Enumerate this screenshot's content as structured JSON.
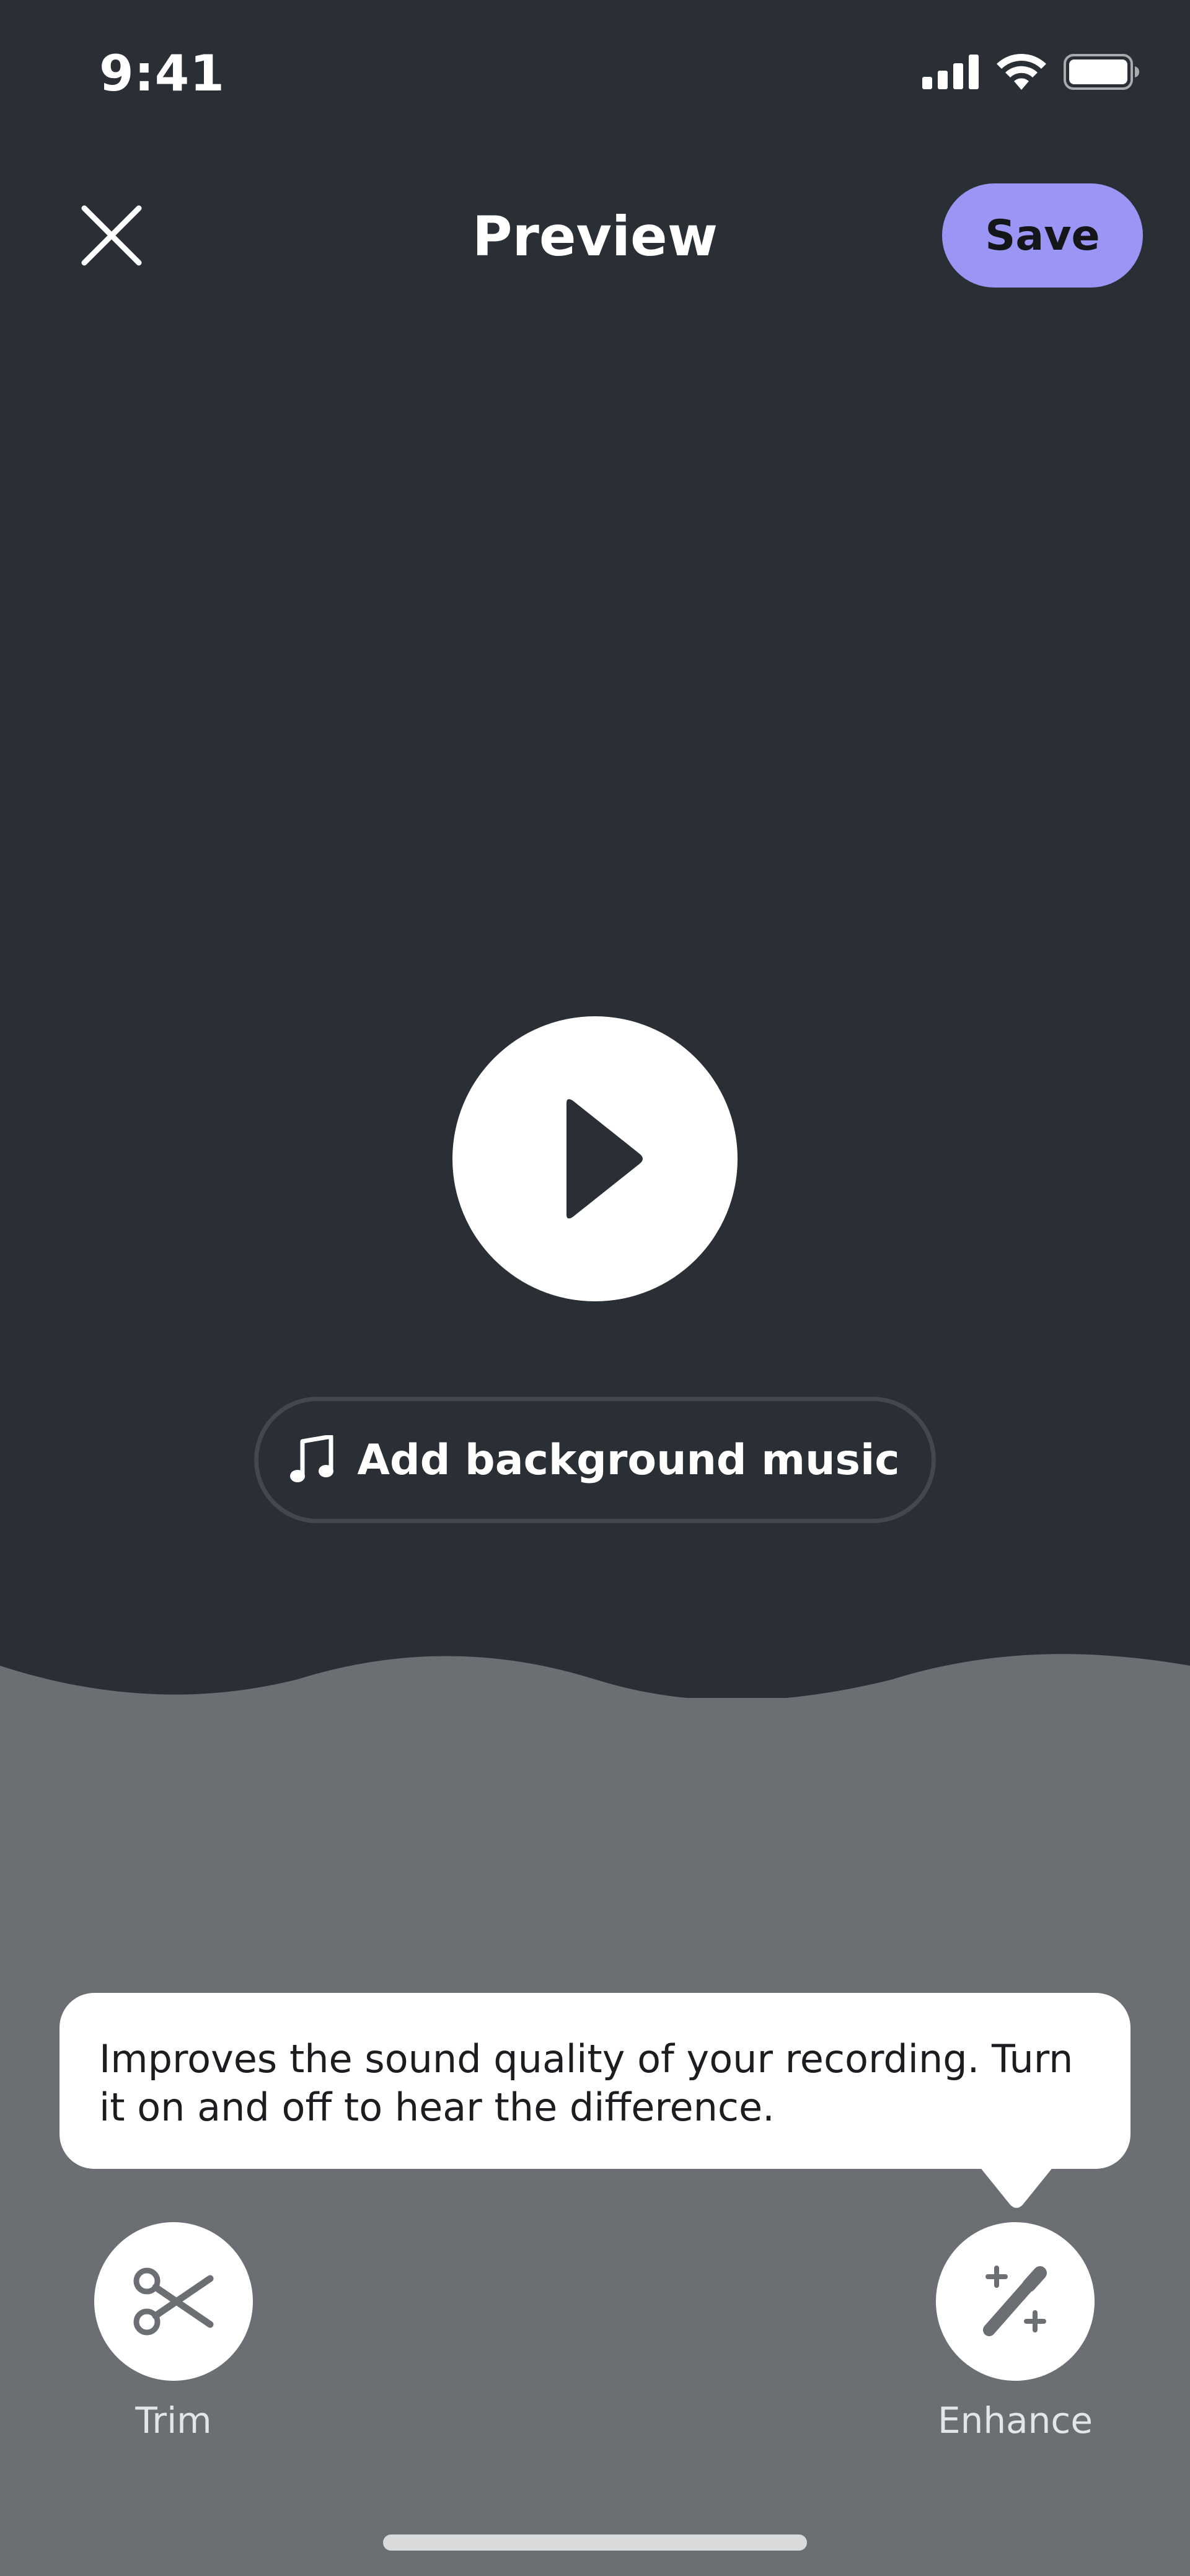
{
  "status_bar": {
    "time": "9:41"
  },
  "header": {
    "title": "Preview",
    "save_label": "Save"
  },
  "player": {
    "add_music_label": "Add background music"
  },
  "tooltip": {
    "text": "Improves the sound quality of your recording. Turn it on and off to hear the difference."
  },
  "tools": [
    {
      "label": "Trim",
      "icon": "scissors-icon"
    },
    {
      "label": "Enhance",
      "icon": "magic-wand-icon"
    }
  ],
  "colors": {
    "background_top": "#2a2e35",
    "background_bottom": "#6b6e72",
    "accent": "#9b96f5",
    "white": "#ffffff"
  }
}
